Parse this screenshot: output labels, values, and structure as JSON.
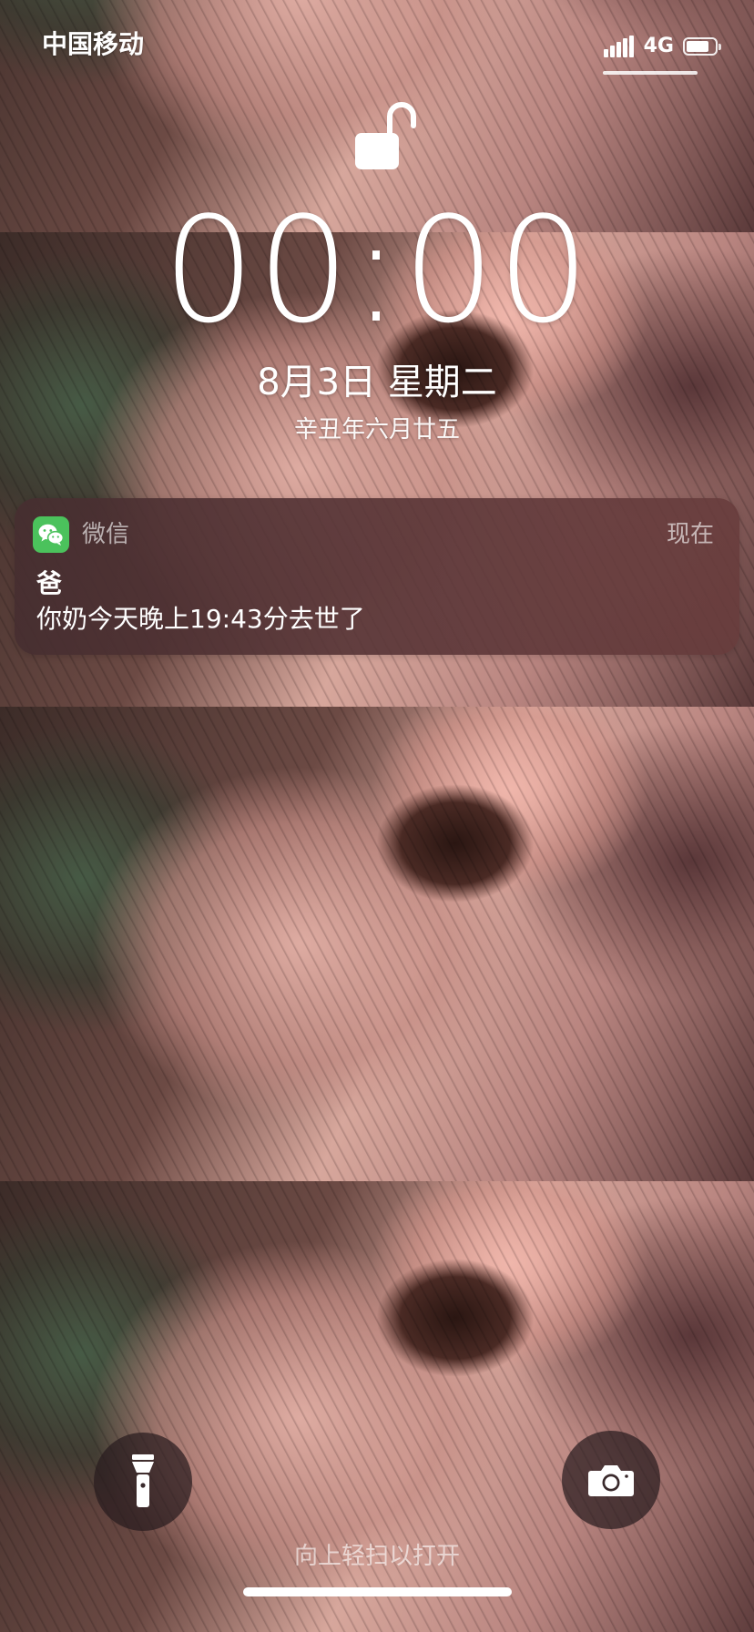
{
  "status_bar": {
    "carrier": "中国移动",
    "network": "4G",
    "battery_level": 0.8
  },
  "lock_screen": {
    "time": "00:00",
    "date": "8月3日 星期二",
    "lunar_date": "辛丑年六月廿五"
  },
  "notification": {
    "app_name": "微信",
    "time": "现在",
    "title": "爸",
    "body": "你奶今天晚上19:43分去世了",
    "app_icon": "wechat-icon"
  },
  "bottom_bar": {
    "flashlight_icon": "flashlight-icon",
    "camera_icon": "camera-icon",
    "unlock_hint": "向上轻扫以打开"
  },
  "colors": {
    "notification_bg": "#5a3638",
    "wechat_green": "#4bc25c",
    "button_bg": "#2a1c1e"
  }
}
